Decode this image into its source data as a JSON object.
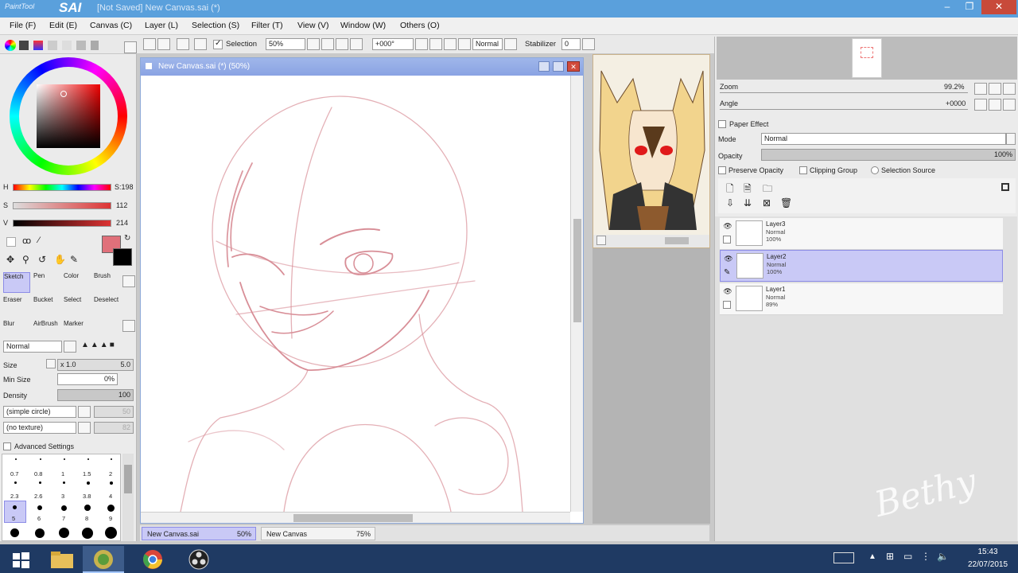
{
  "app": {
    "logo_text": "PaintTool",
    "brand": "SAI",
    "document_title": "[Not Saved] New Canvas.sai (*)"
  },
  "window_controls": {
    "minimize": "–",
    "maximize": "❐",
    "close": "✕"
  },
  "menu": [
    "File (F)",
    "Edit (E)",
    "Canvas (C)",
    "Layer (L)",
    "Selection (S)",
    "Filter (T)",
    "View (V)",
    "Window (W)",
    "Others (O)"
  ],
  "toolbar": {
    "selection_label": "Selection",
    "zoom_value": "50%",
    "angle_value": "+000°",
    "blend_mode": "Normal",
    "stabilizer_label": "Stabilizer",
    "stabilizer_value": "0"
  },
  "color": {
    "hsv": [
      {
        "label": "H",
        "value": "S:198"
      },
      {
        "label": "S",
        "value": "112"
      },
      {
        "label": "V",
        "value": "214"
      }
    ],
    "primary_hex": "#e0707a",
    "secondary_hex": "#000000"
  },
  "tools": {
    "grid": [
      {
        "name": "Sketch"
      },
      {
        "name": "Pen"
      },
      {
        "name": "Color"
      },
      {
        "name": "Brush"
      },
      {
        "name": "Eraser"
      },
      {
        "name": "Bucket"
      },
      {
        "name": "Select"
      },
      {
        "name": "Deselect"
      },
      {
        "name": "Blur"
      },
      {
        "name": "AirBrush"
      },
      {
        "name": "Marker"
      }
    ],
    "brush_mode": "Normal",
    "size_label": "Size",
    "size_multiplier": "x 1.0",
    "size_value": "5.0",
    "min_size_label": "Min Size",
    "min_size_value": "0%",
    "density_label": "Density",
    "density_value": "100",
    "shape": "(simple circle)",
    "shape_value": "50",
    "texture": "(no texture)",
    "texture_value": "82",
    "advanced_label": "Advanced Settings",
    "sizes_row1": [
      "0.7",
      "0.8",
      "1",
      "1.5",
      "2"
    ],
    "sizes_row2": [
      "2.3",
      "2.6",
      "3",
      "3.8",
      "4"
    ],
    "sizes_row3": [
      "5",
      "6",
      "7",
      "8",
      "9"
    ]
  },
  "canvas": {
    "title": "New Canvas.sai (*) (50%)"
  },
  "navigator": {
    "zoom_label": "Zoom",
    "zoom_value": "99.2%",
    "angle_label": "Angle",
    "angle_value": "+0000"
  },
  "layer_panel": {
    "paper_effect": "Paper Effect",
    "mode_label": "Mode",
    "mode_value": "Normal",
    "opacity_label": "Opacity",
    "opacity_value": "100%",
    "preserve_opacity": "Preserve Opacity",
    "clipping_group": "Clipping Group",
    "selection_source": "Selection Source",
    "layers": [
      {
        "name": "Layer3",
        "mode": "Normal",
        "opacity": "100%"
      },
      {
        "name": "Layer2",
        "mode": "Normal",
        "opacity": "100%"
      },
      {
        "name": "Layer1",
        "mode": "Normal",
        "opacity": "89%"
      }
    ]
  },
  "tabs": [
    {
      "name": "New Canvas.sai",
      "zoom": "50%"
    },
    {
      "name": "New Canvas",
      "zoom": "75%"
    }
  ],
  "taskbar": {
    "time": "15:43",
    "date": "22/07/2015"
  },
  "watermark": "Bethy",
  "colors": {
    "title_bar": "#5aa0dc",
    "canvas_header": "#8aa3e3",
    "sketch_stroke": "#d88e97",
    "selected_layer": "#c9c9f6",
    "taskbar": "#1f3a63"
  }
}
